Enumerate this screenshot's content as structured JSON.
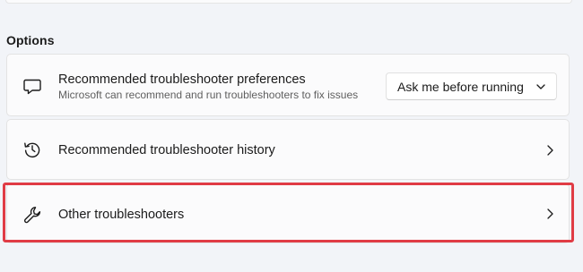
{
  "section": {
    "title": "Options"
  },
  "items": [
    {
      "label": "Recommended troubleshooter preferences",
      "description": "Microsoft can recommend and run troubleshooters to fix issues",
      "icon": "chat-bubble-icon",
      "control": {
        "type": "dropdown",
        "selected": "Ask me before running",
        "icon": "chevron-down-icon"
      }
    },
    {
      "label": "Recommended troubleshooter history",
      "icon": "history-icon",
      "action_icon": "chevron-right-icon"
    },
    {
      "label": "Other troubleshooters",
      "icon": "wrench-icon",
      "action_icon": "chevron-right-icon",
      "highlighted": true
    }
  ],
  "colors": {
    "background": "#f2f4f8",
    "card": "#fbfbfc",
    "highlight_border": "#e03c45",
    "primary_text": "#1b1b1b",
    "secondary_text": "#5f5f5f"
  }
}
